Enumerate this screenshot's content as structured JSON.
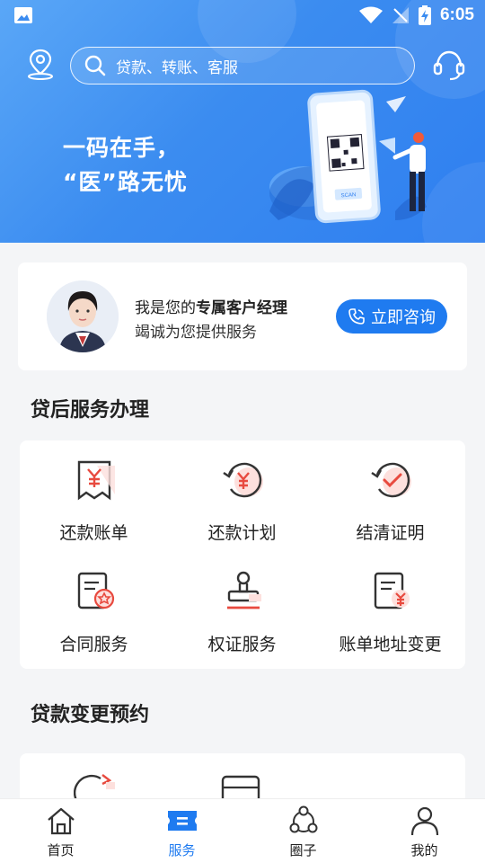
{
  "status_bar": {
    "time": "6:05"
  },
  "header": {
    "search_placeholder": "贷款、转账、客服",
    "slogan_line1": "一码在手，",
    "slogan_line2": "“医”路无忧",
    "illustration_scan_text": "SCAN"
  },
  "manager": {
    "line1_prefix": "我是您的",
    "line1_bold": "专属客户经理",
    "line2": "竭诚为您提供服务",
    "consult_label": "立即咨询"
  },
  "section_after_loan": {
    "title": "贷后服务办理"
  },
  "services": [
    {
      "label": "还款账单",
      "icon": "repayment-bill-icon"
    },
    {
      "label": "还款计划",
      "icon": "repayment-plan-icon"
    },
    {
      "label": "结清证明",
      "icon": "settlement-proof-icon"
    },
    {
      "label": "合同服务",
      "icon": "contract-service-icon"
    },
    {
      "label": "权证服务",
      "icon": "warrant-service-icon"
    },
    {
      "label": "账单地址变更",
      "icon": "bill-address-change-icon"
    }
  ],
  "section_change": {
    "title": "贷款变更预约"
  },
  "bottom_nav": [
    {
      "label": "首页",
      "icon": "home-icon",
      "active": false
    },
    {
      "label": "服务",
      "icon": "service-ticket-icon",
      "active": true
    },
    {
      "label": "圈子",
      "icon": "circle-icon",
      "active": false
    },
    {
      "label": "我的",
      "icon": "profile-icon",
      "active": false
    }
  ],
  "colors": {
    "primary": "#1f7bf0",
    "accent_red": "#e84a3f",
    "banner": "#3b8cf0"
  }
}
